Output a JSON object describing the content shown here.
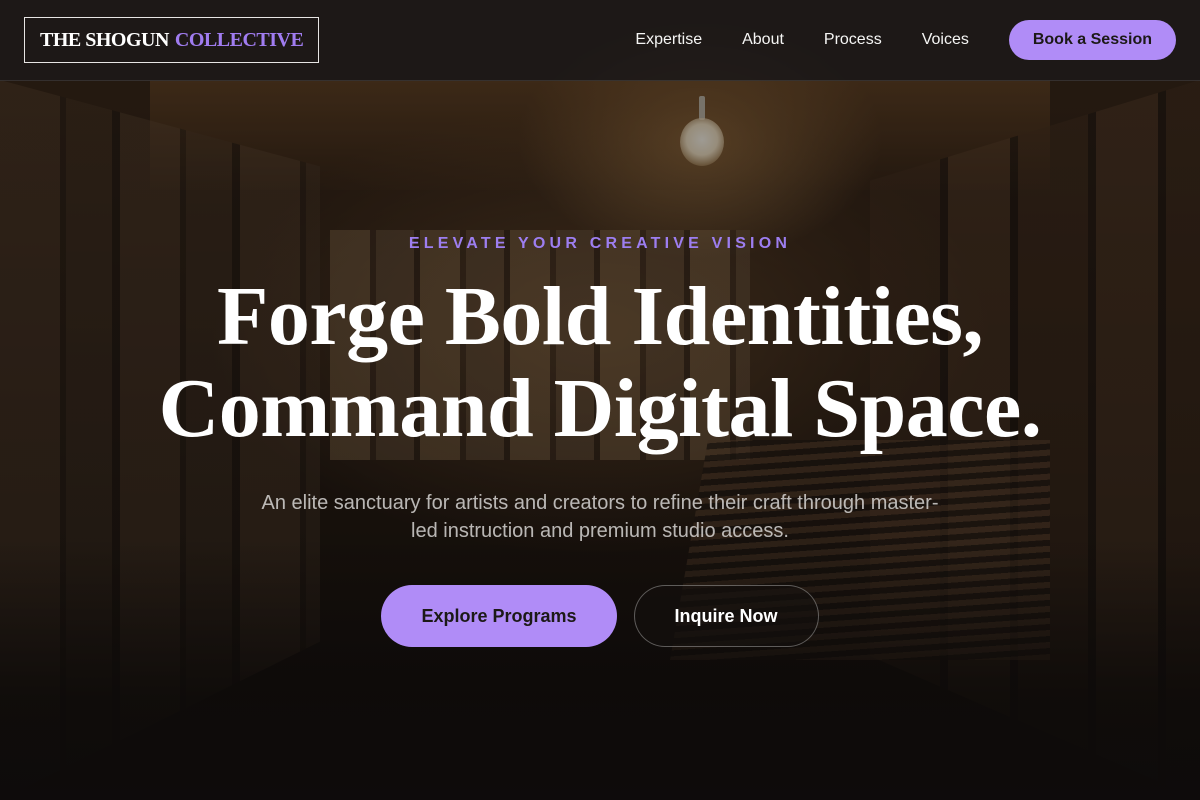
{
  "brand": {
    "name_part1": "THE SHOGUN",
    "name_part2": "COLLECTIVE"
  },
  "nav": {
    "items": [
      {
        "label": "Expertise"
      },
      {
        "label": "About"
      },
      {
        "label": "Process"
      },
      {
        "label": "Voices"
      }
    ],
    "cta_label": "Book a Session"
  },
  "hero": {
    "eyebrow": "ELEVATE YOUR CREATIVE VISION",
    "headline_line1": "Forge Bold Identities,",
    "headline_line2": "Command Digital Space.",
    "subtitle": "An elite sanctuary for artists and creators to refine their craft through master-led instruction and premium studio access.",
    "primary_button": "Explore Programs",
    "secondary_button": "Inquire Now"
  },
  "colors": {
    "accent": "#b08cf7",
    "eyebrow": "#9d7ef0",
    "header_bg": "#1c1918"
  }
}
